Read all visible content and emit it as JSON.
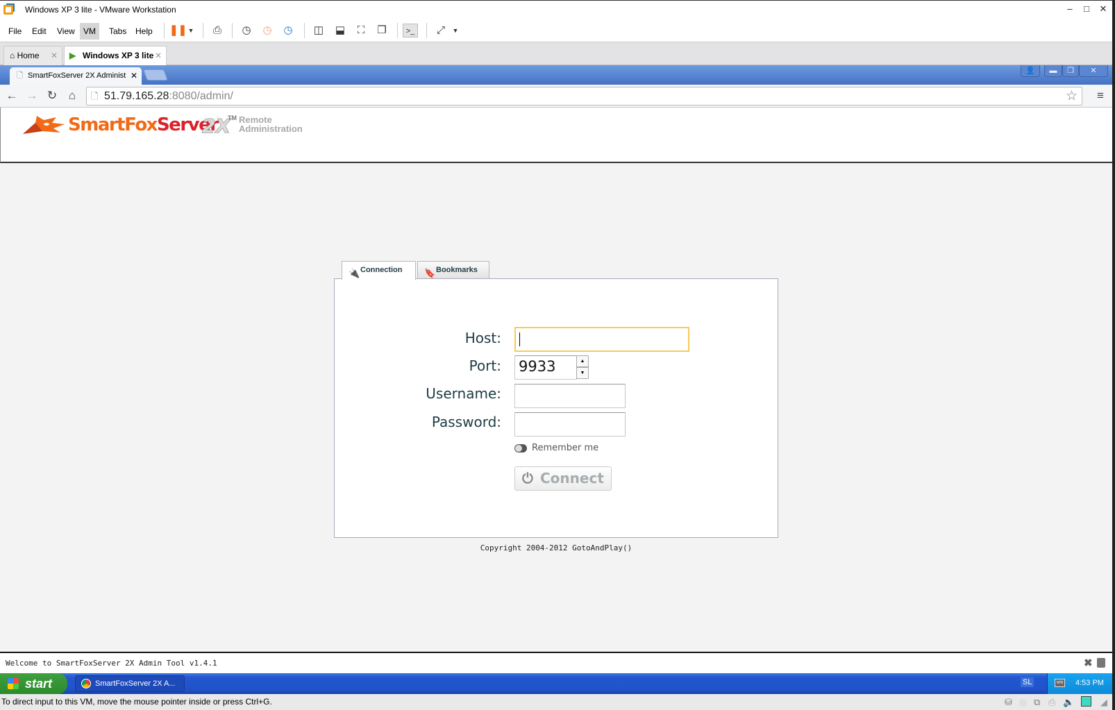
{
  "window": {
    "title": "Windows XP 3 lite - VMware Workstation",
    "minimize": "–",
    "maximize": "□",
    "close": "✕"
  },
  "menu": {
    "items": [
      "File",
      "Edit",
      "View",
      "VM",
      "Tabs",
      "Help"
    ],
    "selected": "VM"
  },
  "vmware_tabs": [
    {
      "label": "Home",
      "active": false
    },
    {
      "label": "Windows XP 3 lite",
      "active": true
    }
  ],
  "browser": {
    "tab_title": "SmartFoxServer 2X Administ",
    "url_host": "51.79.165.28",
    "url_rest": ":8080/admin/"
  },
  "logo": {
    "brand_a": "SmartFox",
    "brand_b": "Server",
    "version": "2X",
    "tm": "TM",
    "subtitle_1": "Remote",
    "subtitle_2": "Administration"
  },
  "login": {
    "tabs": [
      {
        "label": "Connection",
        "icon": "plug-icon",
        "active": true
      },
      {
        "label": "Bookmarks",
        "icon": "bookmark-icon",
        "active": false
      }
    ],
    "host_label": "Host:",
    "host_value": "",
    "port_label": "Port:",
    "port_value": "9933",
    "username_label": "Username:",
    "username_value": "",
    "password_label": "Password:",
    "password_value": "",
    "remember_label": "Remember me",
    "remember_checked": false,
    "connect_label": "Connect",
    "focus_color": "#f6cb55"
  },
  "copyright": "Copyright 2004-2012 GotoAndPlay()",
  "status_message": "Welcome to SmartFoxServer 2X Admin Tool v1.4.1",
  "taskbar": {
    "start_label": "start",
    "task_label": "SmartFoxServer 2X A...",
    "lang": "SL",
    "clock": "4:53 PM",
    "vm_icon_text": "vm"
  },
  "vm_status_text": "To direct input to this VM, move the mouse pointer inside or press Ctrl+G."
}
